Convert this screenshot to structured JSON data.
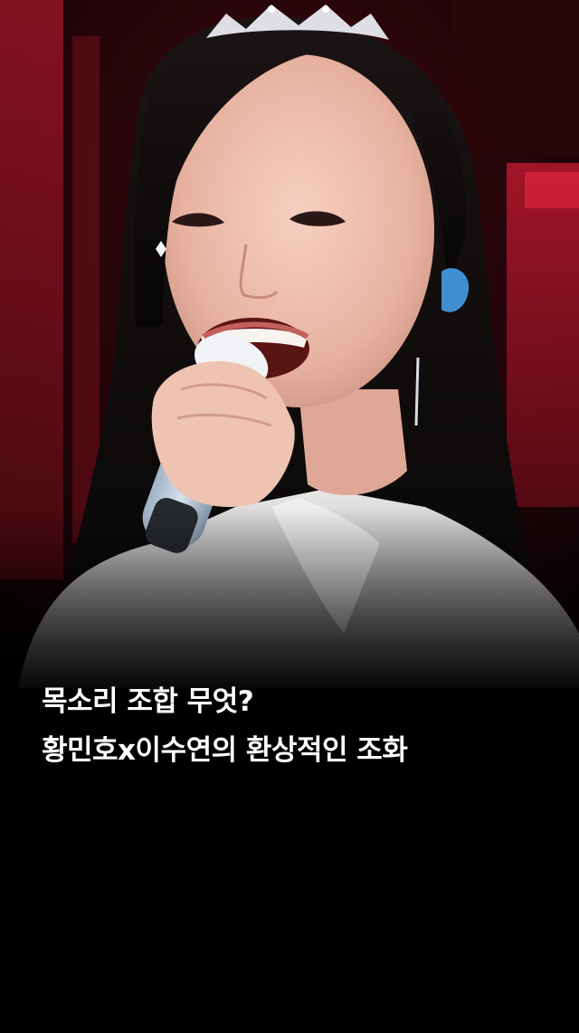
{
  "caption": {
    "line1": "목소리 조합 무엇?",
    "line2": "황민호x이수연의 환상적인 조화"
  },
  "photo": {
    "subject": "singer-with-tiara-and-microphone-icon"
  },
  "colors": {
    "background": "#000000",
    "stage_red": "#8c1222",
    "caption_text": "#ffffff"
  }
}
